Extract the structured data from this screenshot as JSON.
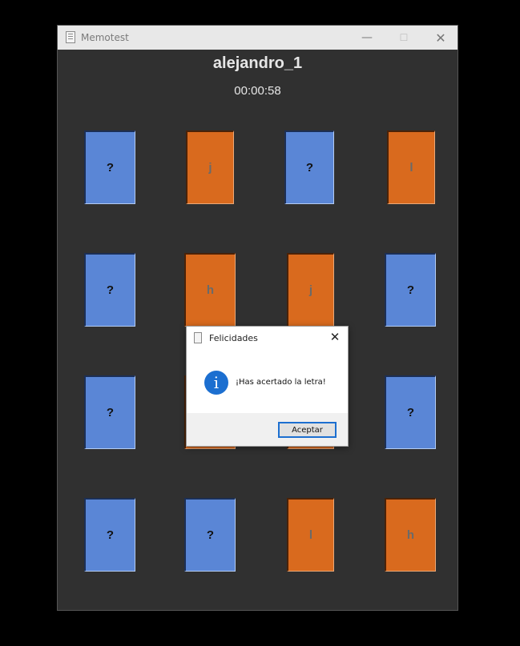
{
  "window": {
    "title": "Memotest",
    "minimize_glyph": "—",
    "maximize_glyph": "☐",
    "close_glyph": "✕"
  },
  "game": {
    "player": "alejandro_1",
    "timer": "00:00:58"
  },
  "cards": [
    [
      "?",
      "j",
      "?",
      "l"
    ],
    [
      "?",
      "h",
      "j",
      "?"
    ],
    [
      "?",
      "",
      "",
      "?"
    ],
    [
      "?",
      "?",
      "l",
      "h"
    ]
  ],
  "dialog": {
    "title": "Felicidades",
    "close_glyph": "✕",
    "icon_glyph": "i",
    "message": "¡Has acertado la letra!",
    "button_label": "Aceptar"
  },
  "colors": {
    "hidden_card": "#5a86d6",
    "revealed_card": "#d96a1e",
    "background": "#303030",
    "accent": "#1c6fd0"
  }
}
